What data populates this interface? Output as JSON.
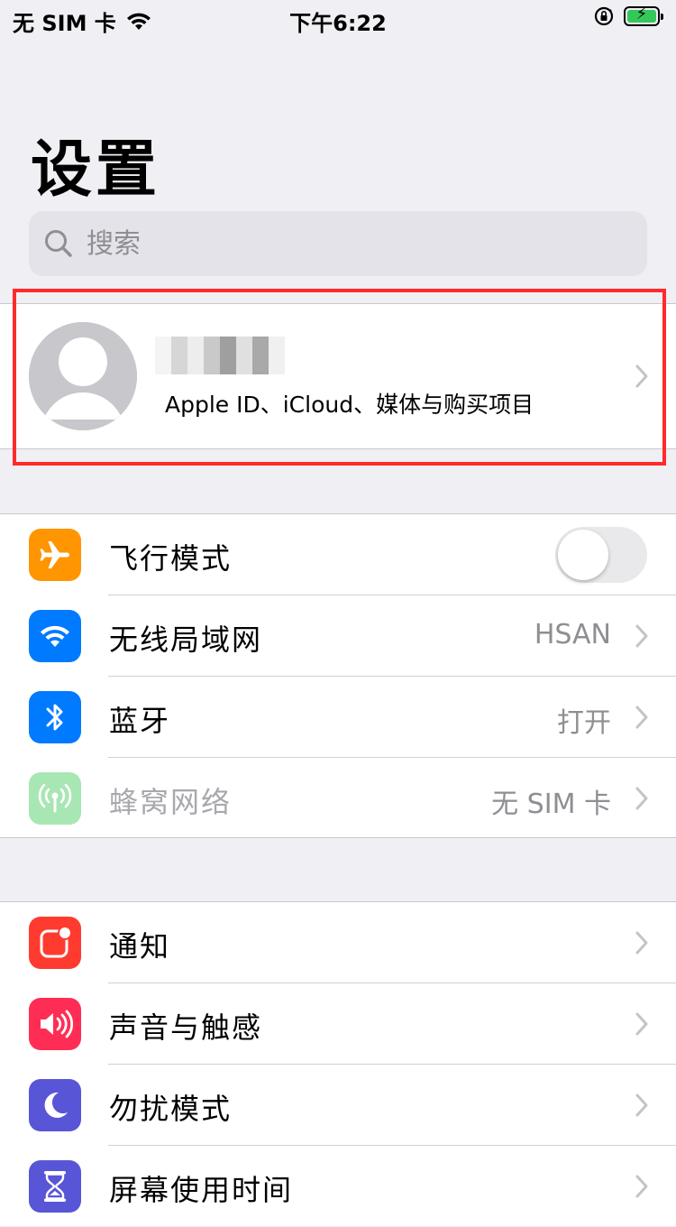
{
  "status_bar": {
    "carrier": "无 SIM 卡",
    "time": "下午6:22",
    "battery_percent": 100
  },
  "page": {
    "title": "设置"
  },
  "search": {
    "placeholder": "搜索"
  },
  "profile": {
    "subtitle": "Apple ID、iCloud、媒体与购买项目"
  },
  "colors": {
    "airplane": "#ff9500",
    "wifi": "#007aff",
    "bluetooth": "#007aff",
    "cellular": "#a8e6b4",
    "notifications": "#ff3b30",
    "sounds": "#ff2d55",
    "dnd": "#5856d6",
    "screen_time": "#5856d6",
    "highlight": "#ff2a2a"
  },
  "group1": {
    "items": [
      {
        "label": "飞行模式",
        "icon": "airplane-icon",
        "toggle_on": false
      },
      {
        "label": "无线局域网",
        "icon": "wifi-icon",
        "value": "HSAN"
      },
      {
        "label": "蓝牙",
        "icon": "bluetooth-icon",
        "value": "打开"
      },
      {
        "label": "蜂窝网络",
        "icon": "cellular-antenna-icon",
        "value": "无 SIM 卡"
      }
    ]
  },
  "group2": {
    "items": [
      {
        "label": "通知",
        "icon": "notifications-icon"
      },
      {
        "label": "声音与触感",
        "icon": "speaker-icon"
      },
      {
        "label": "勿扰模式",
        "icon": "moon-icon"
      },
      {
        "label": "屏幕使用时间",
        "icon": "hourglass-icon"
      }
    ]
  }
}
